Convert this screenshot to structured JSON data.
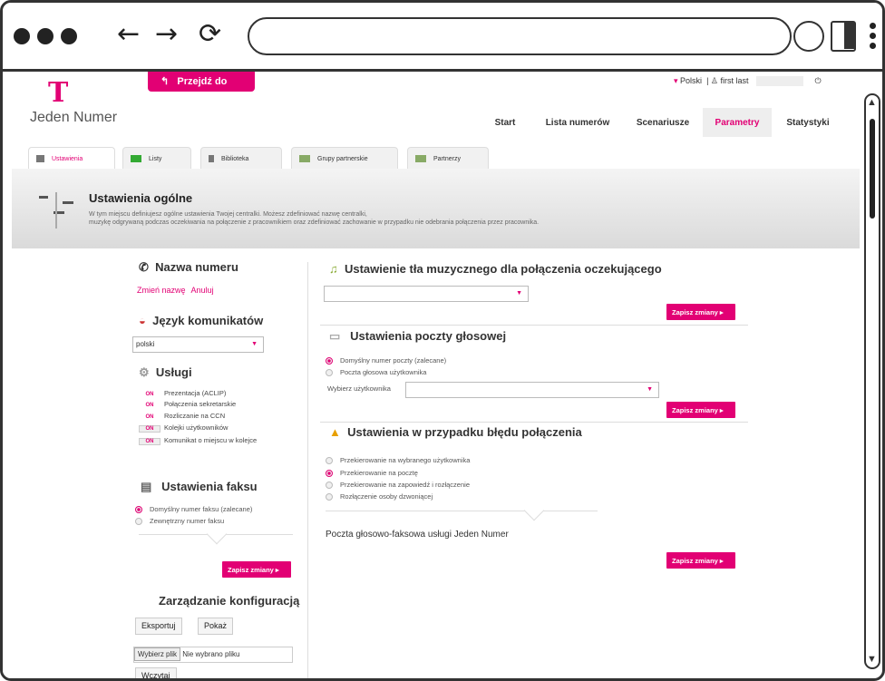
{
  "header": {
    "logo_letter": "T",
    "brand": "Jeden Numer",
    "goto_label": "Przejdź do",
    "language": "Polski",
    "user": "first last"
  },
  "nav": [
    "Start",
    "Lista numerów",
    "Scenariusze",
    "Parametry",
    "Statystyki"
  ],
  "nav_active": "Parametry",
  "tabs": [
    "Ustawienia",
    "Listy",
    "Biblioteka",
    "Grupy partnerskie",
    "Partnerzy"
  ],
  "band": {
    "title": "Ustawienia ogólne",
    "desc1": "W tym miejscu definiujesz ogólne ustawienia Twojej centralki. Możesz zdefiniować nazwę centralki,",
    "desc2": "muzykę odgrywaną podczas oczekiwania na połączenie z pracownikiem oraz zdefiniować zachowanie w przypadku nie odebrania połączenia przez pracownika."
  },
  "left": {
    "number_title": "Nazwa numeru",
    "rename": "Zmień nazwę",
    "cancel": "Anuluj",
    "lang_title": "Język komunikatów",
    "lang_value": "polski",
    "services_title": "Usługi",
    "services": [
      {
        "state": "ON",
        "label": "Prezentacja (ACLIP)"
      },
      {
        "state": "ON",
        "label": "Połączenia sekretarskie"
      },
      {
        "state": "ON",
        "label": "Rozliczanie na CCN"
      },
      {
        "state": "ON",
        "label": "Kolejki użytkowników"
      },
      {
        "state": "ON",
        "label": "Komunikat o miejscu w kolejce"
      }
    ],
    "fax_title": "Ustawienia faksu",
    "fax_options": [
      "Domyślny numer faksu (zalecane)",
      "Zewnętrzny numer faksu"
    ],
    "save": "Zapisz zmiany ▸",
    "config_title": "Zarządzanie konfiguracją",
    "export": "Eksportuj",
    "show": "Pokaż",
    "choose_file": "Wybierz plik",
    "no_file": "Nie wybrano pliku",
    "load": "Wczytaj"
  },
  "right": {
    "music_title": "Ustawienie tła muzycznego dla połączenia oczekującego",
    "voicemail_title": "Ustawienia poczty głosowej",
    "voicemail_options": [
      "Domyślny numer poczty (zalecane)",
      "Poczta głosowa użytkownika"
    ],
    "choose_user": "Wybierz użytkownika",
    "error_title": "Ustawienia w przypadku błędu połączenia",
    "error_options": [
      "Przekierowanie na wybranego użytkownika",
      "Przekierowanie na pocztę",
      "Przekierowanie na zapowiedź i rozłączenie",
      "Rozłączenie osoby dzwoniącej"
    ],
    "fax_mail": "Poczta głosowo-faksowa usługi Jeden Numer",
    "save": "Zapisz zmiany ▸"
  },
  "colors": {
    "accent": "#e20074"
  }
}
